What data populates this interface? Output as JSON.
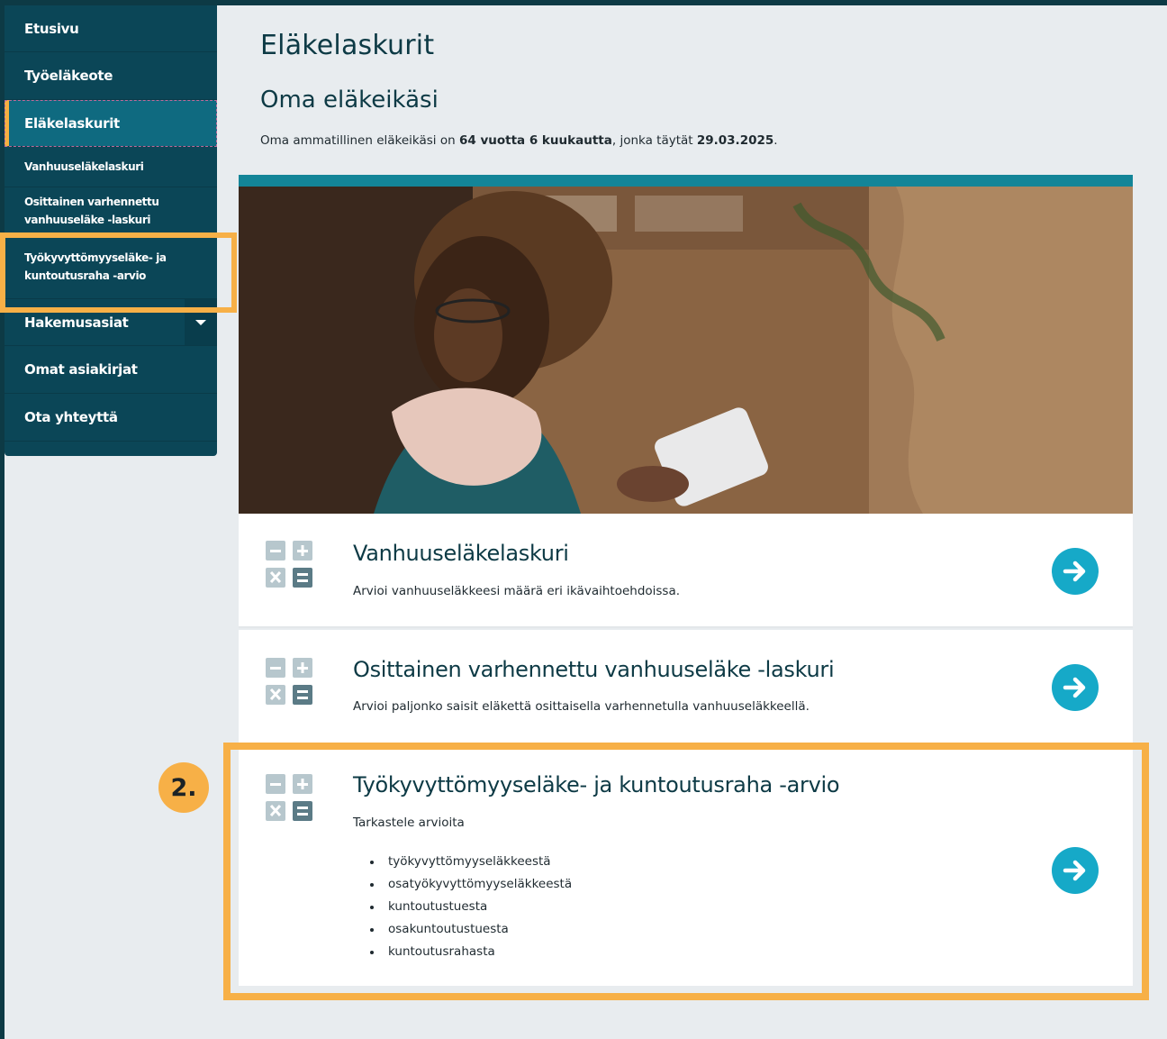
{
  "sidebar": {
    "items": [
      {
        "label": "Etusivu"
      },
      {
        "label": "Työeläkeote"
      },
      {
        "label": "Eläkelaskurit"
      },
      {
        "label": "Vanhuuseläkelaskuri"
      },
      {
        "label": "Osittainen varhennettu vanhuuseläke -laskuri"
      },
      {
        "label": "Työkyvyttömyyseläke- ja kuntoutusraha -arvio"
      },
      {
        "label": "Hakemusasiat"
      },
      {
        "label": "Omat asiakirjat"
      },
      {
        "label": "Ota yhteyttä"
      }
    ],
    "active_item": "Eläkelaskurit"
  },
  "main": {
    "page_title": "Eläkelaskurit",
    "section_title": "Oma eläkeikäsi",
    "intro_prefix": "Oma ammatillinen eläkeikäsi on ",
    "intro_age": "64 vuotta 6 kuukautta",
    "intro_mid": ", jonka täytät ",
    "intro_date": "29.03.2025",
    "intro_suffix": "."
  },
  "cards": [
    {
      "title": "Vanhuuseläkelaskuri",
      "description": "Arvioi vanhuuseläkkeesi määrä eri ikävaihtoehdoissa.",
      "icon": "calculator-icon",
      "action_icon": "arrow-right-icon"
    },
    {
      "title": "Osittainen varhennettu vanhuuseläke -laskuri",
      "description": "Arvioi paljonko saisit eläkettä osittaisella varhennetulla vanhuuseläkkeellä.",
      "icon": "calculator-icon",
      "action_icon": "arrow-right-icon"
    },
    {
      "title": "Työkyvyttömyyseläke- ja kuntoutusraha -arvio",
      "description": "Tarkastele arvioita",
      "bullets": [
        "työkyvyttömyyseläkkeestä",
        "osatyökyvyttömyyseläkkeestä",
        "kuntoutustuesta",
        "osakuntoutustuesta",
        "kuntoutusrahasta"
      ],
      "icon": "calculator-icon",
      "action_icon": "arrow-right-icon"
    }
  ],
  "annotation": {
    "step_label": "2.",
    "highlight_color": "#f7b047"
  },
  "colors": {
    "sidebar_bg": "#0b4657",
    "active_bg": "#0f6a80",
    "accent_bar": "#138598",
    "arrow_button": "#16a9c8",
    "highlight": "#f7b047"
  }
}
